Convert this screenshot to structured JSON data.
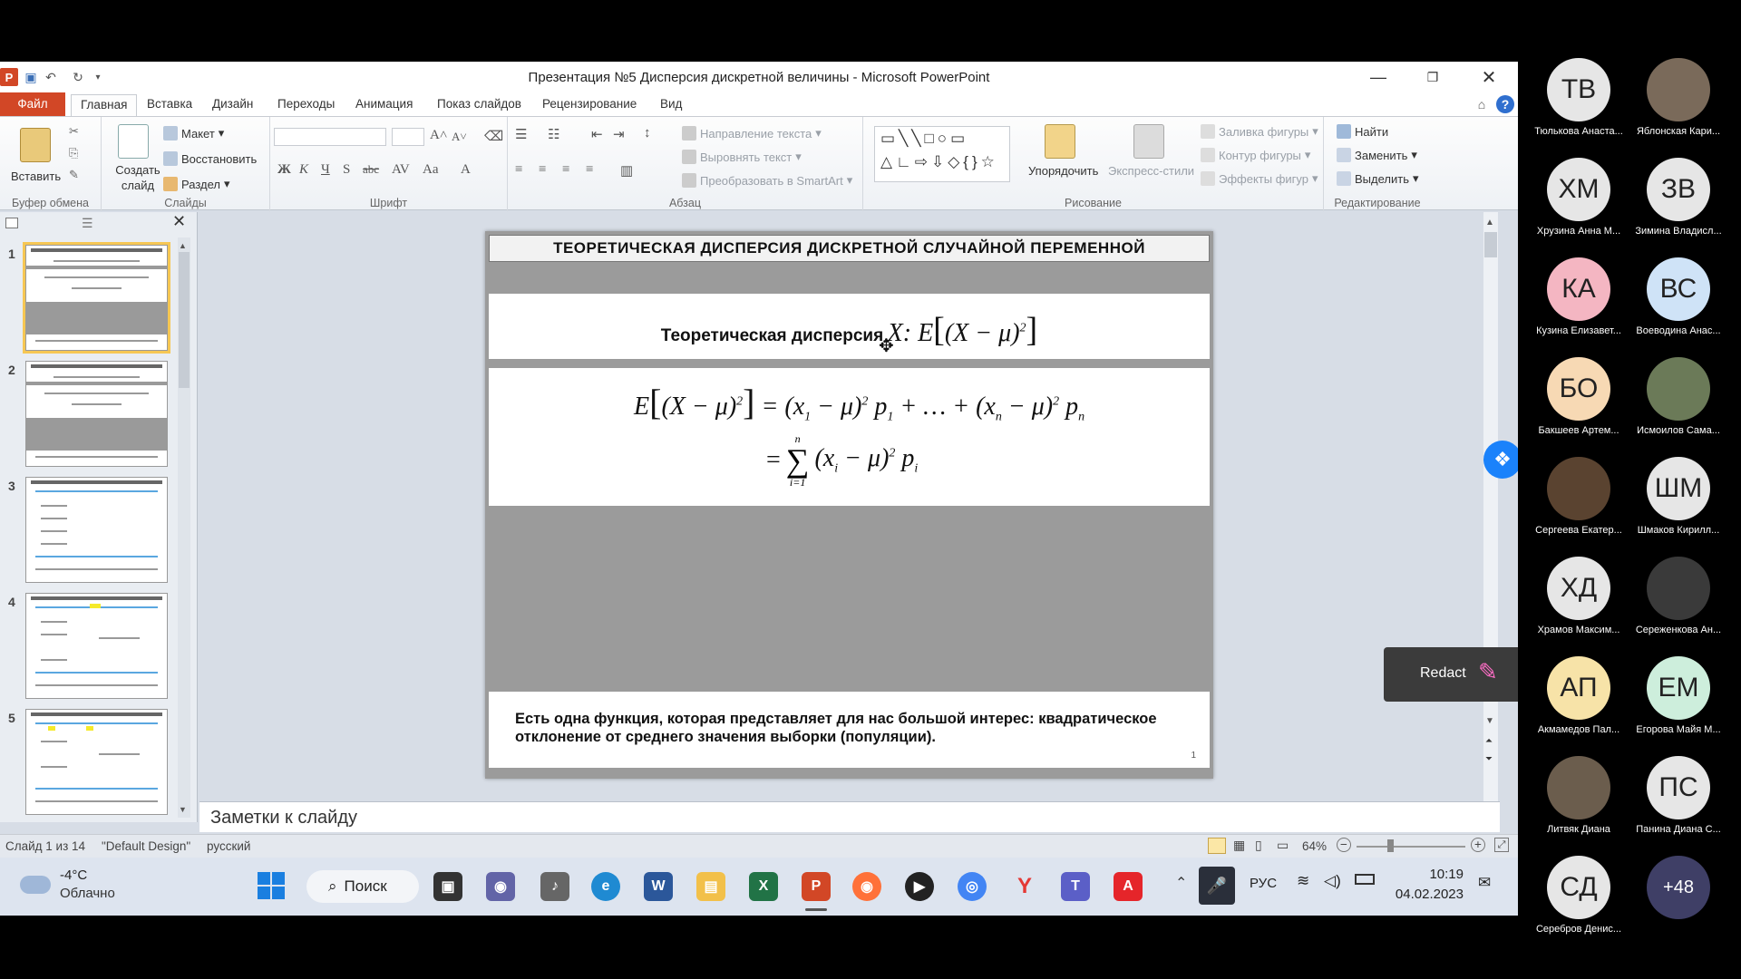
{
  "window": {
    "title": "Презентация №5 Дисперсия дискретной величины - Microsoft PowerPoint"
  },
  "tabs": [
    "Файл",
    "Главная",
    "Вставка",
    "Дизайн",
    "Переходы",
    "Анимация",
    "Показ слайдов",
    "Рецензирование",
    "Вид"
  ],
  "ribbon": {
    "clipboard": {
      "paste": "Вставить",
      "label": "Буфер обмена"
    },
    "slides": {
      "new_slide": "Создать слайд",
      "layout": "Макет",
      "reset": "Восстановить",
      "section": "Раздел",
      "label": "Слайды"
    },
    "font": {
      "label": "Шрифт"
    },
    "paragraph": {
      "text_direction": "Направление текста",
      "align_text": "Выровнять текст",
      "smartart": "Преобразовать в SmartArt",
      "label": "Абзац"
    },
    "drawing": {
      "arrange": "Упорядочить",
      "quick_styles": "Экспресс-стили",
      "shape_fill": "Заливка фигуры",
      "shape_outline": "Контур фигуры",
      "shape_effects": "Эффекты фигур",
      "label": "Рисование"
    },
    "editing": {
      "find": "Найти",
      "replace": "Заменить",
      "select": "Выделить",
      "label": "Редактирование"
    }
  },
  "thumbnails": [
    "1",
    "2",
    "3",
    "4",
    "5"
  ],
  "slide": {
    "title": "ТЕОРЕТИЧЕСКАЯ ДИСПЕРСИЯ ДИСКРЕТНОЙ СЛУЧАЙНОЙ ПЕРЕМЕННОЙ",
    "label": "Теоретическая дисперсия",
    "caption": "Есть одна функция, которая представляет для нас большой интерес: квадратическое отклонение от среднего значения выборки (популяции).",
    "number": "1"
  },
  "notes_placeholder": "Заметки к слайду",
  "status": {
    "slide_info": "Слайд 1 из 14",
    "theme": "\"Default Design\"",
    "language": "русский",
    "zoom": "64%"
  },
  "overlay": {
    "redact": "Redact"
  },
  "taskbar": {
    "temp": "-4°C",
    "weather": "Облачно",
    "search": "Поиск",
    "lang": "РУС",
    "time": "10:19",
    "date": "04.02.2023"
  },
  "participants": [
    {
      "initials": "ТВ",
      "name": "Тюлькова Анаста...",
      "color": "#e6e6e6"
    },
    {
      "initials": "",
      "name": "Яблонская Кари...",
      "color": "#7a6a5a"
    },
    {
      "initials": "ХМ",
      "name": "Хрузина Анна М...",
      "color": "#e6e6e6"
    },
    {
      "initials": "ЗВ",
      "name": "Зимина Владисл...",
      "color": "#e6e6e6"
    },
    {
      "initials": "КА",
      "name": "Кузина Елизавет...",
      "color": "#f4b6c2"
    },
    {
      "initials": "ВС",
      "name": "Воеводина Анас...",
      "color": "#cfe3f7"
    },
    {
      "initials": "БО",
      "name": "Бакшеев Артем...",
      "color": "#f7d9b4"
    },
    {
      "initials": "",
      "name": "Исмоилов Сама...",
      "color": "#6b7a58"
    },
    {
      "initials": "",
      "name": "Сергеева Екатер...",
      "color": "#5a4330"
    },
    {
      "initials": "ШМ",
      "name": "Шмаков Кирилл...",
      "color": "#e6e6e6"
    },
    {
      "initials": "ХД",
      "name": "Храмов Максим...",
      "color": "#e6e6e6"
    },
    {
      "initials": "",
      "name": "Сереженкова Ан...",
      "color": "#3a3a3a"
    },
    {
      "initials": "АП",
      "name": "Акмамедов Пал...",
      "color": "#f7e3a8"
    },
    {
      "initials": "ЕМ",
      "name": "Егорова Майя М...",
      "color": "#cdeedc"
    },
    {
      "initials": "",
      "name": "Литвяк Диана",
      "color": "#6b5d4d"
    },
    {
      "initials": "ПС",
      "name": "Панина Диана С...",
      "color": "#e6e6e6"
    },
    {
      "initials": "СД",
      "name": "Серебров Денис...",
      "color": "#e6e6e6"
    },
    {
      "initials": "+48",
      "name": "",
      "color": "#3f3f66"
    }
  ]
}
